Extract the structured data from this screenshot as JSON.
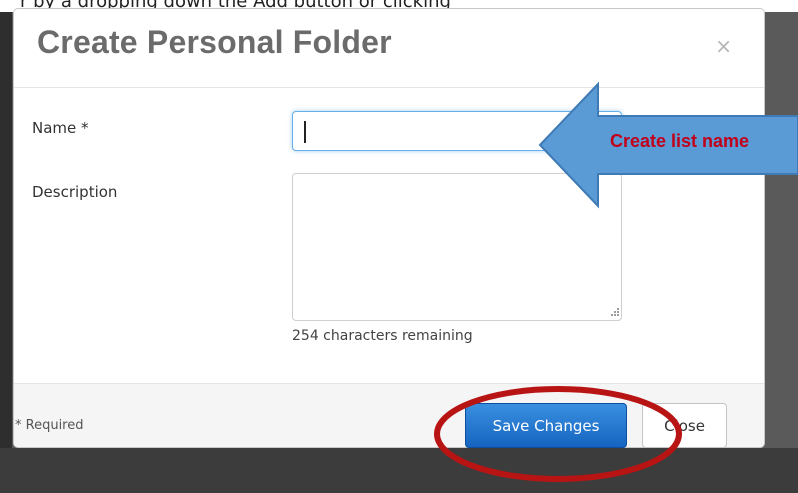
{
  "backdrop": {
    "top_text": "r by a dropping down the Add button or clicking"
  },
  "dialog": {
    "title": "Create Personal Folder",
    "close_icon": "×",
    "name_label": "Name *",
    "name_value": "",
    "description_label": "Description",
    "description_value": "",
    "chars_remaining": "254 characters remaining",
    "required_note": "* Required",
    "save_label": "Save Changes",
    "close_label": "Close"
  },
  "annotations": {
    "callout_text": "Create list name",
    "arrow_color": "#5b9bd5",
    "callout_text_color": "#c0001a",
    "ellipse_color": "#b81414"
  },
  "colors": {
    "primary_button": "#1f6fd0",
    "focus_border": "#66afe9"
  }
}
